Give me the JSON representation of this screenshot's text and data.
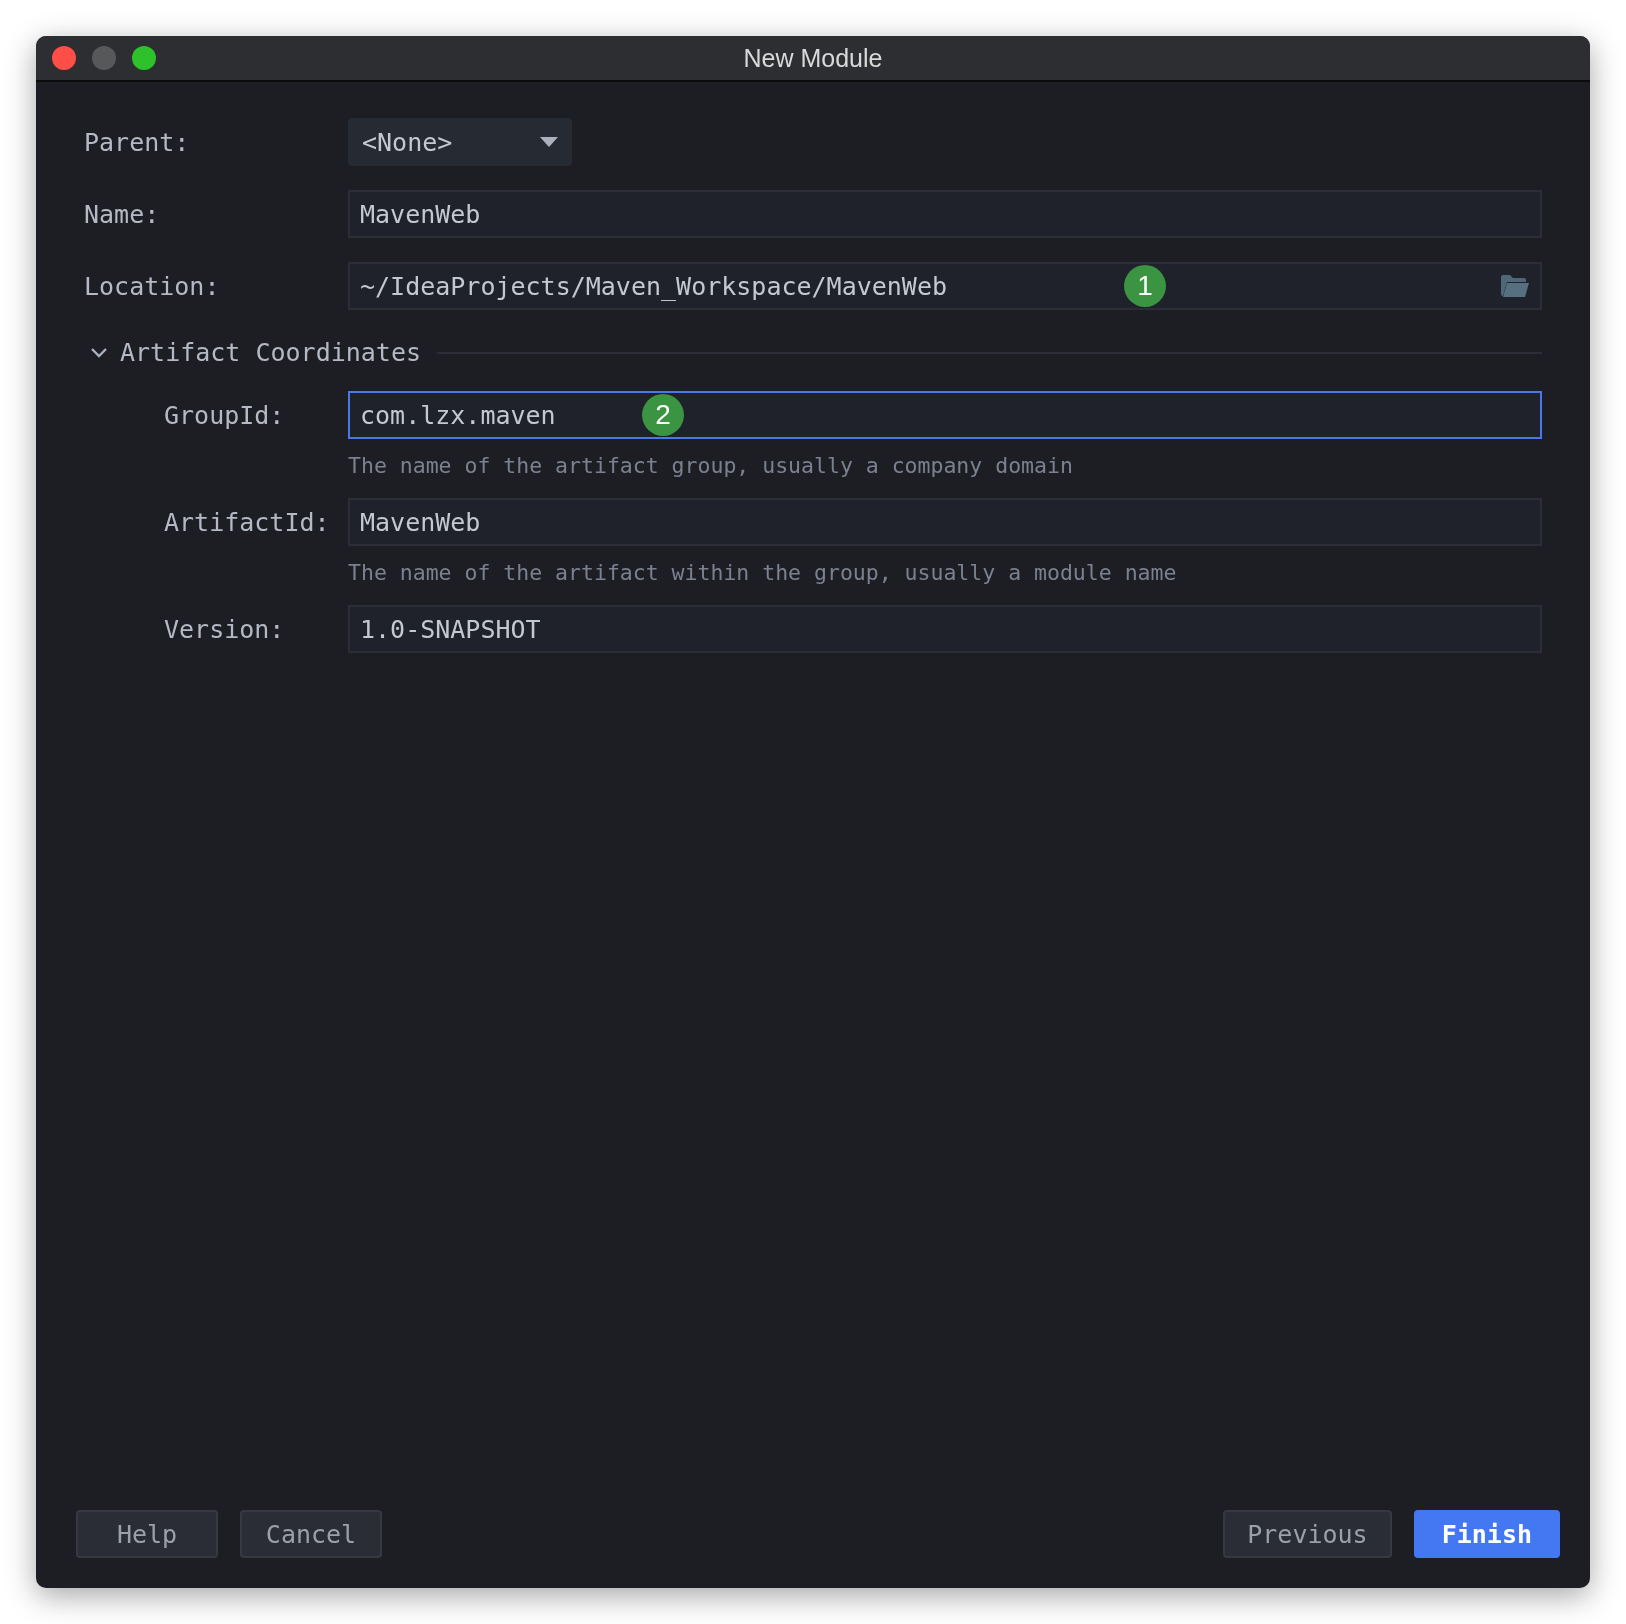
{
  "window": {
    "title": "New Module"
  },
  "fields": [
    {
      "label": "Parent:",
      "kind": "dropdown",
      "value": "<None>"
    },
    {
      "label": "Name:",
      "kind": "text",
      "value": "MavenWeb"
    },
    {
      "label": "Location:",
      "kind": "path",
      "value": "~/IdeaProjects/Maven_Workspace/MavenWeb",
      "badge": "1"
    }
  ],
  "section": {
    "title": "Artifact Coordinates",
    "expanded": true,
    "fields": [
      {
        "label": "GroupId:",
        "value": "com.lzx.maven",
        "focused": true,
        "badge": "2",
        "hint": "The name of the artifact group, usually a company domain"
      },
      {
        "label": "ArtifactId:",
        "value": "MavenWeb",
        "focused": false,
        "hint": "The name of the artifact within the group, usually a module name"
      },
      {
        "label": "Version:",
        "value": "1.0-SNAPSHOT",
        "focused": false
      }
    ]
  },
  "buttons_left": [
    {
      "label": "Help",
      "primary": false
    },
    {
      "label": "Cancel",
      "primary": false
    }
  ],
  "buttons_right": [
    {
      "label": "Previous",
      "primary": false
    },
    {
      "label": "Finish",
      "primary": true
    }
  ]
}
